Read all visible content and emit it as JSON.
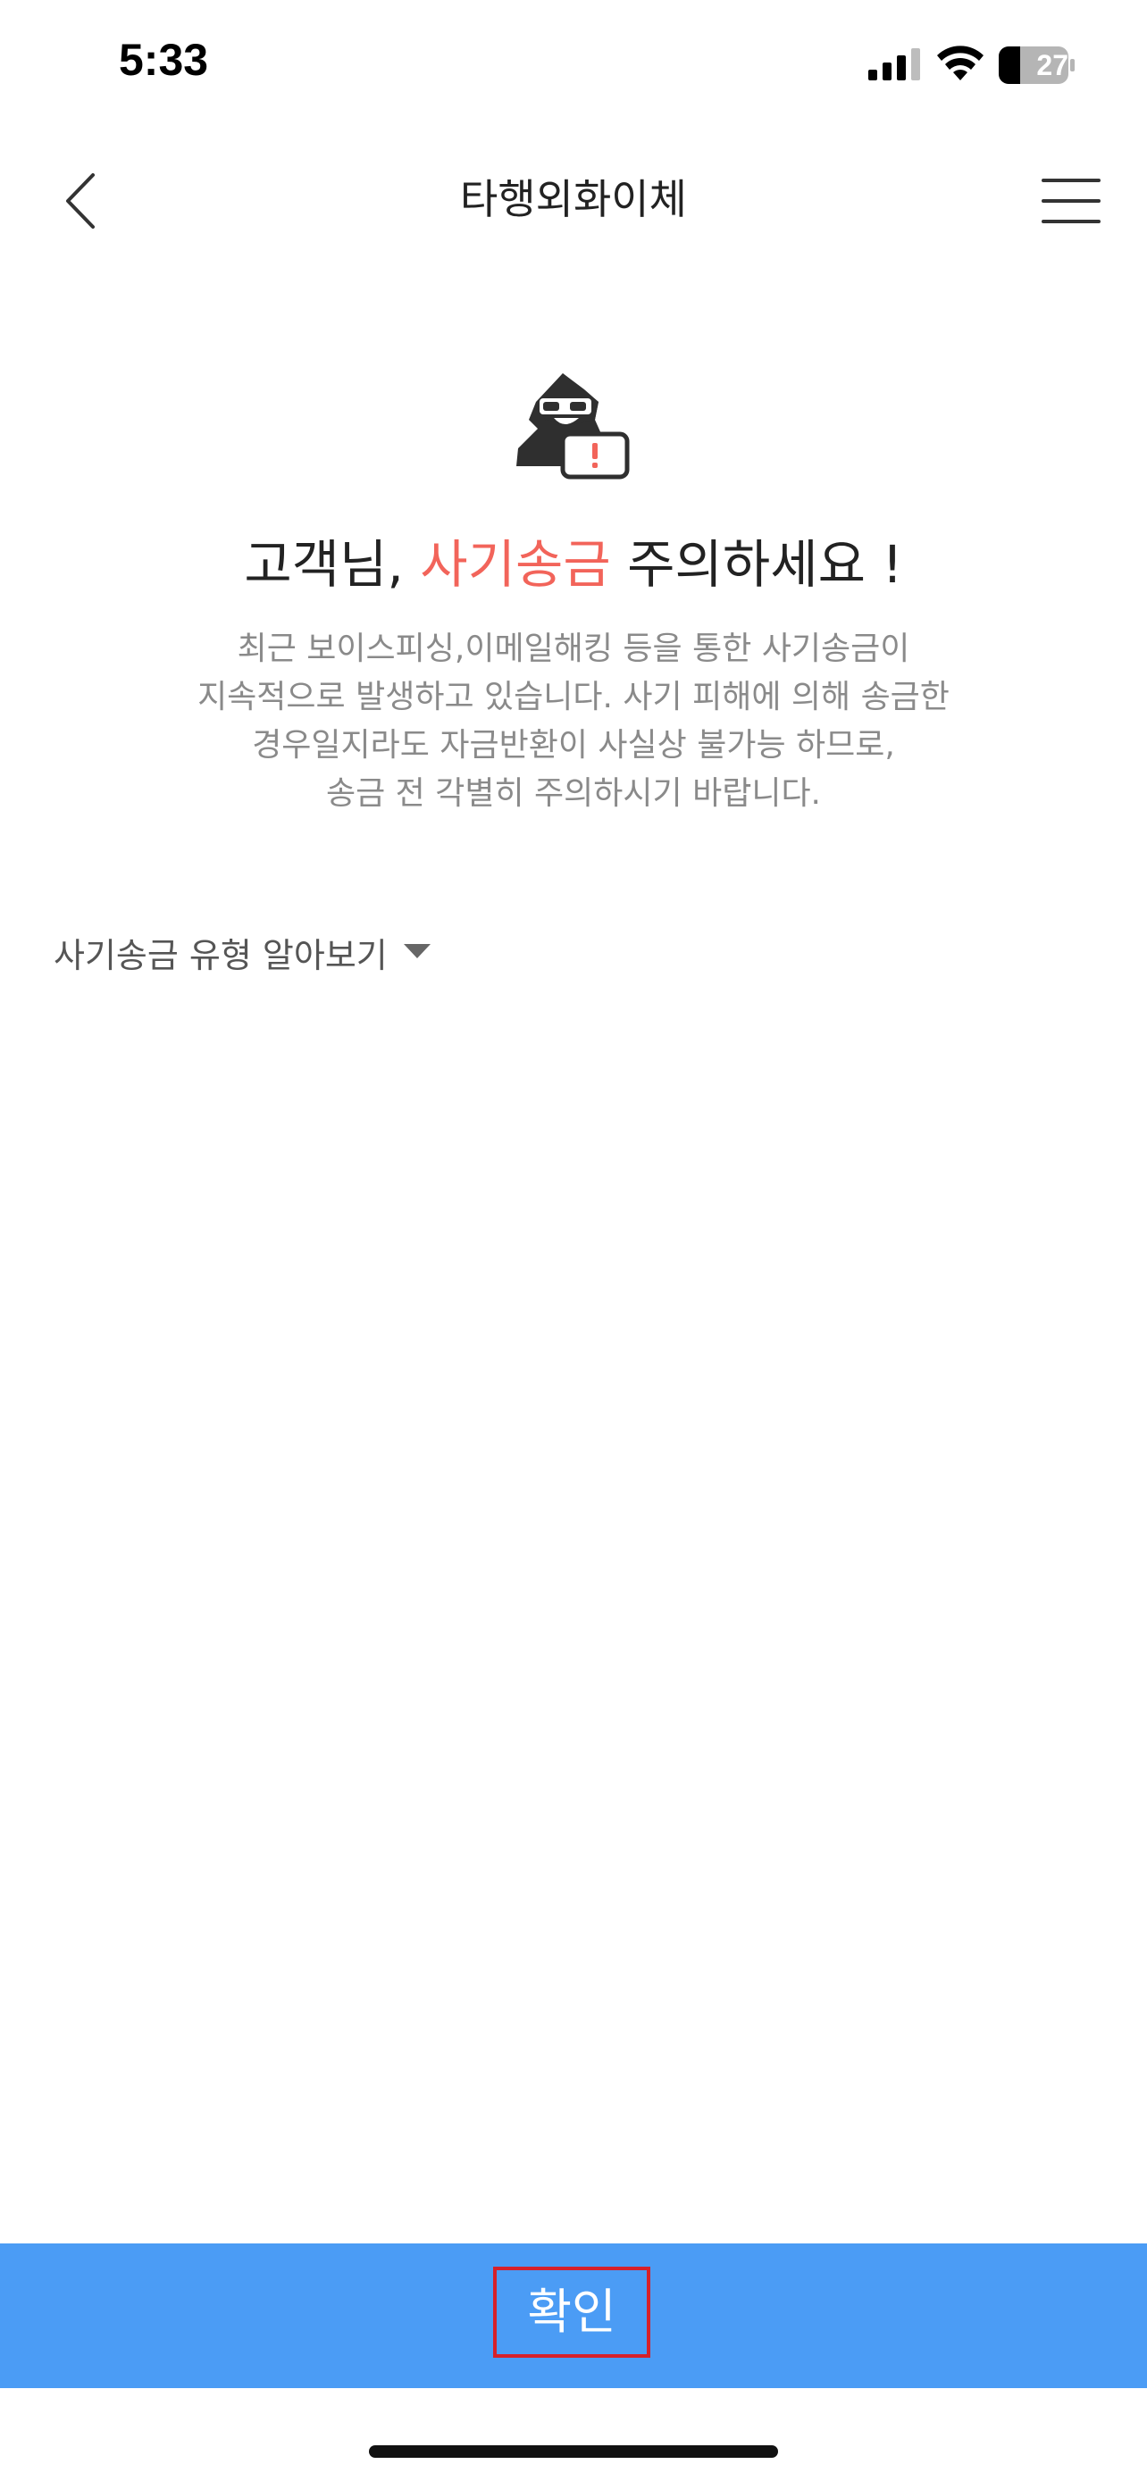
{
  "status_bar": {
    "time": "5:33",
    "battery": "27"
  },
  "header": {
    "title": "타행외화이체",
    "back_icon": "chevron-left-icon",
    "menu_icon": "hamburger-menu-icon"
  },
  "warning": {
    "icon": "hacker-warning-icon",
    "headline_prefix": "고객님, ",
    "headline_accent": "사기송금",
    "headline_suffix": " 주의하세요 !",
    "accent_color": "#f2645a",
    "description_lines": [
      "최근 보이스피싱,이메일해킹 등을 통한 사기송금이",
      "지속적으로 발생하고 있습니다. 사기 피해에 의해 송금한",
      "경우일지라도 자금반환이 사실상 불가능 하므로,",
      "송금 전 각별히 주의하시기 바랍니다."
    ]
  },
  "fraud_types": {
    "label": "사기송금 유형 알아보기",
    "icon": "caret-down-icon"
  },
  "footer": {
    "confirm_label": "확인",
    "button_color": "#4b9cf5"
  }
}
